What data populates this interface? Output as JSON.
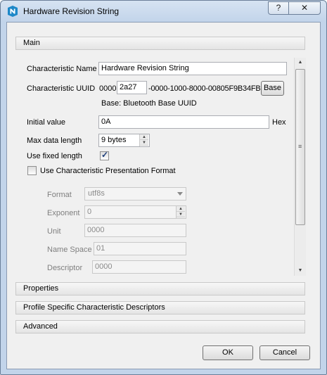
{
  "window": {
    "title": "Hardware Revision String",
    "help_label": "?",
    "close_label": "✕"
  },
  "sections": {
    "main": "Main",
    "properties": "Properties",
    "profile": "Profile Specific Characteristic Descriptors",
    "advanced": "Advanced"
  },
  "form": {
    "name_label": "Characteristic Name",
    "name_value": "Hardware Revision String",
    "uuid_label": "Characteristic UUID",
    "uuid_prefix": "0000",
    "uuid_value": "2a27",
    "uuid_suffix": "-0000-1000-8000-00805F9B34FB",
    "base_button": "Base",
    "base_note": "Base: Bluetooth Base UUID",
    "initial_label": "Initial value",
    "initial_value": "0A",
    "initial_unit": "Hex",
    "maxlen_label": "Max data length",
    "maxlen_value": "9 bytes",
    "fixed_label": "Use fixed length",
    "fixed_checked": true,
    "cpf_label": "Use Characteristic Presentation Format",
    "cpf_checked": false
  },
  "presentation": {
    "format_label": "Format",
    "format_value": "utf8s",
    "exponent_label": "Exponent",
    "exponent_value": "0",
    "unit_label": "Unit",
    "unit_value": "0000",
    "namespace_label": "Name Space",
    "namespace_value": "01",
    "descriptor_label": "Descriptor",
    "descriptor_value": "0000"
  },
  "buttons": {
    "ok": "OK",
    "cancel": "Cancel"
  }
}
